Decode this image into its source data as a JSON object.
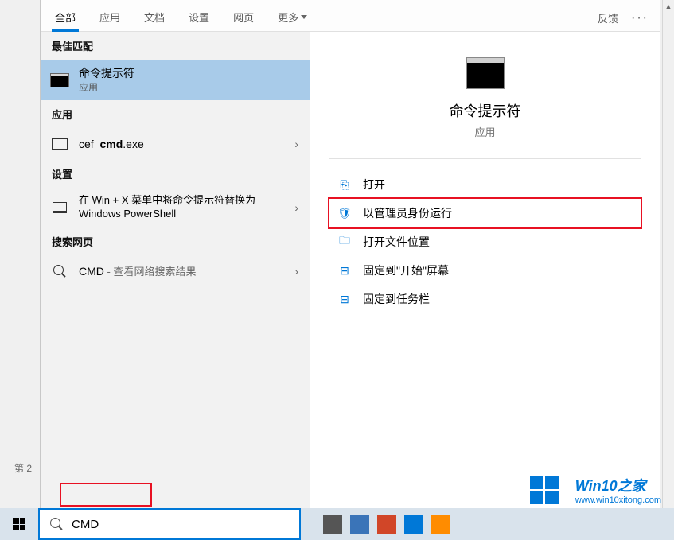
{
  "filters": {
    "all": "全部",
    "apps": "应用",
    "docs": "文档",
    "settings": "设置",
    "web": "网页",
    "more": "更多",
    "feedback": "反馈"
  },
  "left": {
    "best_match": "最佳匹配",
    "item1_title": "命令提示符",
    "item1_sub": "应用",
    "apps_header": "应用",
    "item2_prefix": "cef_",
    "item2_bold": "cmd",
    "item2_suffix": ".exe",
    "settings_header": "设置",
    "item3_text": "在 Win + X 菜单中将命令提示符替换为 Windows PowerShell",
    "web_header": "搜索网页",
    "item4_term": "CMD",
    "item4_suffix": " - 查看网络搜索结果"
  },
  "preview": {
    "title": "命令提示符",
    "sub": "应用",
    "open": "打开",
    "run_admin": "以管理员身份运行",
    "open_loc": "打开文件位置",
    "pin_start": "固定到\"开始\"屏幕",
    "pin_taskbar": "固定到任务栏"
  },
  "search": {
    "query": "CMD"
  },
  "page_label": "第 2",
  "watermark": {
    "title": "Win10之家",
    "url": "www.win10xitong.com"
  }
}
